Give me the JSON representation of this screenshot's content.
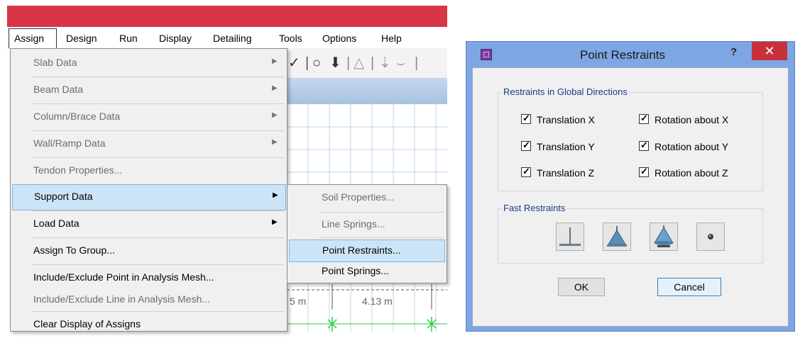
{
  "menubar": {
    "items": [
      "Assign",
      "Design",
      "Run",
      "Display",
      "Detailing",
      "Tools",
      "Options",
      "Help"
    ]
  },
  "assign_menu": {
    "items": [
      {
        "label": "Slab Data",
        "enabled": false,
        "submenu": true
      },
      {
        "label": "Beam Data",
        "enabled": false,
        "submenu": true
      },
      {
        "label": "Column/Brace Data",
        "enabled": false,
        "submenu": true
      },
      {
        "label": "Wall/Ramp Data",
        "enabled": false,
        "submenu": true
      },
      {
        "label": "Tendon Properties...",
        "enabled": false,
        "submenu": false
      },
      {
        "label": "Support Data",
        "enabled": true,
        "submenu": true,
        "highlighted": true
      },
      {
        "label": "Load Data",
        "enabled": true,
        "submenu": true
      },
      {
        "label": "Assign To Group...",
        "enabled": true,
        "submenu": false
      },
      {
        "label": "Include/Exclude Point in Analysis Mesh...",
        "enabled": true,
        "submenu": false
      },
      {
        "label": "Include/Exclude Line in Analysis Mesh...",
        "enabled": false,
        "submenu": false
      },
      {
        "label": "Clear Display of Assigns",
        "enabled": true,
        "submenu": false
      }
    ]
  },
  "support_submenu": {
    "items": [
      {
        "label": "Soil Properties...",
        "enabled": false
      },
      {
        "label": "Line Springs...",
        "enabled": false
      },
      {
        "label": "Point Restraints...",
        "enabled": true,
        "highlighted": true
      },
      {
        "label": "Point Springs...",
        "enabled": true
      }
    ]
  },
  "canvas": {
    "dimension_left": "5 m",
    "dimension_right": "4.13 m"
  },
  "dialog": {
    "title": "Point Restraints",
    "help": "?",
    "close": "✕",
    "restraints_group": "Restraints in Global Directions",
    "checkboxes": [
      {
        "label": "Translation X",
        "checked": true
      },
      {
        "label": "Rotation about X",
        "checked": true
      },
      {
        "label": "Translation Y",
        "checked": true
      },
      {
        "label": "Rotation about Y",
        "checked": true
      },
      {
        "label": "Translation Z",
        "checked": true
      },
      {
        "label": "Rotation about Z",
        "checked": true
      }
    ],
    "fast_group": "Fast Restraints",
    "fast_buttons": [
      "fixed-support-icon",
      "pinned-support-icon",
      "fixed-cone-support-icon",
      "free-joint-icon"
    ],
    "ok": "OK",
    "cancel": "Cancel"
  },
  "colors": {
    "titlebar": "#d83548",
    "highlight": "#cce4f7",
    "dialog_frame": "#7fa6e4",
    "close_button": "#c7303b",
    "grid_green": "#2ecc40"
  }
}
